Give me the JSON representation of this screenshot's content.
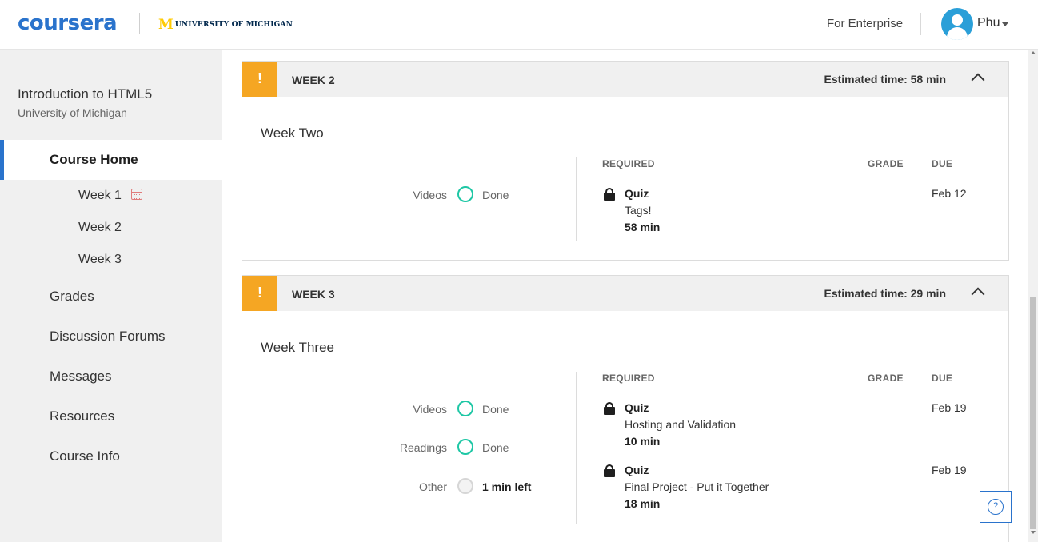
{
  "header": {
    "logo": "coursera",
    "partner_mark": "M",
    "partner_text": "UNIVERSITY OF MICHIGAN",
    "enterprise_link": "For Enterprise",
    "user_name": "Phu",
    "avatar_icon": "user-avatar-icon"
  },
  "sidebar": {
    "course_title": "Introduction to HTML5",
    "course_university": "University of Michigan",
    "active_item": "Course Home",
    "weeks": [
      "Week 1",
      "Week 2",
      "Week 3"
    ],
    "items": [
      "Grades",
      "Discussion Forums",
      "Messages",
      "Resources",
      "Course Info"
    ]
  },
  "columns": {
    "required": "REQUIRED",
    "grade": "GRADE",
    "due": "DUE"
  },
  "weeks": [
    {
      "label": "WEEK 2",
      "warning": "!",
      "estimated_time": "Estimated time: 58 min",
      "name": "Week Two",
      "progress": [
        {
          "label": "Videos",
          "state": "Done",
          "complete": true
        }
      ],
      "items": [
        {
          "type": "Quiz",
          "name": "Tags!",
          "time": "58 min",
          "due": "Feb 12"
        }
      ]
    },
    {
      "label": "WEEK 3",
      "warning": "!",
      "estimated_time": "Estimated time: 29 min",
      "name": "Week Three",
      "progress": [
        {
          "label": "Videos",
          "state": "Done",
          "complete": true
        },
        {
          "label": "Readings",
          "state": "Done",
          "complete": true
        },
        {
          "label": "Other",
          "state": "1 min left",
          "complete": false
        }
      ],
      "items": [
        {
          "type": "Quiz",
          "name": "Hosting and Validation",
          "time": "10 min",
          "due": "Feb 19"
        },
        {
          "type": "Quiz",
          "name": "Final Project - Put it Together",
          "time": "18 min",
          "due": "Feb 19"
        }
      ]
    }
  ],
  "help_button": "?",
  "colors": {
    "brand": "#2a73cc",
    "warning": "#f5a623",
    "done_ring": "#1ec7a5",
    "umich_gold": "#ffcb05",
    "umich_blue": "#00274c"
  }
}
